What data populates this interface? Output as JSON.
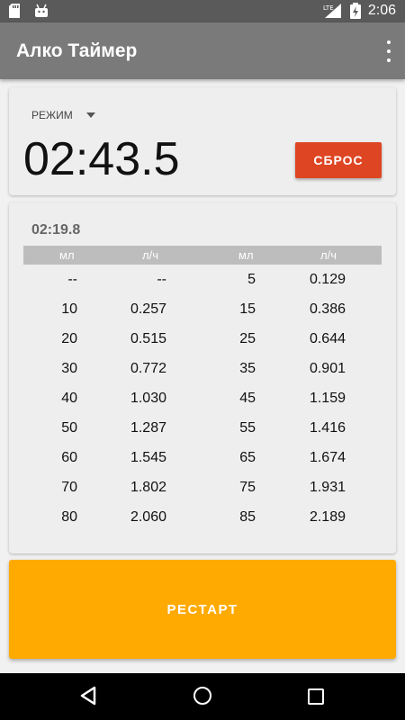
{
  "status_bar": {
    "time": "2:06",
    "network": "LTE",
    "icons": [
      "sd-card-icon",
      "android-icon",
      "signal-icon",
      "battery-charging-icon"
    ]
  },
  "app_bar": {
    "title": "Алко Таймер",
    "menu_icon": "overflow-menu-icon"
  },
  "timer_card": {
    "mode_label": "РЕЖИМ",
    "elapsed": "02:43.5",
    "reset_label": "СБРОС",
    "reset_color": "#de4522"
  },
  "table_card": {
    "lap_time": "02:19.8",
    "headers": [
      "мл",
      "л/ч",
      "мл",
      "л/ч"
    ],
    "rows": [
      [
        "--",
        "--",
        "5",
        "0.129"
      ],
      [
        "10",
        "0.257",
        "15",
        "0.386"
      ],
      [
        "20",
        "0.515",
        "25",
        "0.644"
      ],
      [
        "30",
        "0.772",
        "35",
        "0.901"
      ],
      [
        "40",
        "1.030",
        "45",
        "1.159"
      ],
      [
        "50",
        "1.287",
        "55",
        "1.416"
      ],
      [
        "60",
        "1.545",
        "65",
        "1.674"
      ],
      [
        "70",
        "1.802",
        "75",
        "1.931"
      ],
      [
        "80",
        "2.060",
        "85",
        "2.189"
      ]
    ]
  },
  "restart": {
    "label": "РЕСТАРТ",
    "color": "#ffaa00"
  },
  "nav_bar": {
    "icons": [
      "back-icon",
      "home-icon",
      "recents-icon"
    ]
  }
}
